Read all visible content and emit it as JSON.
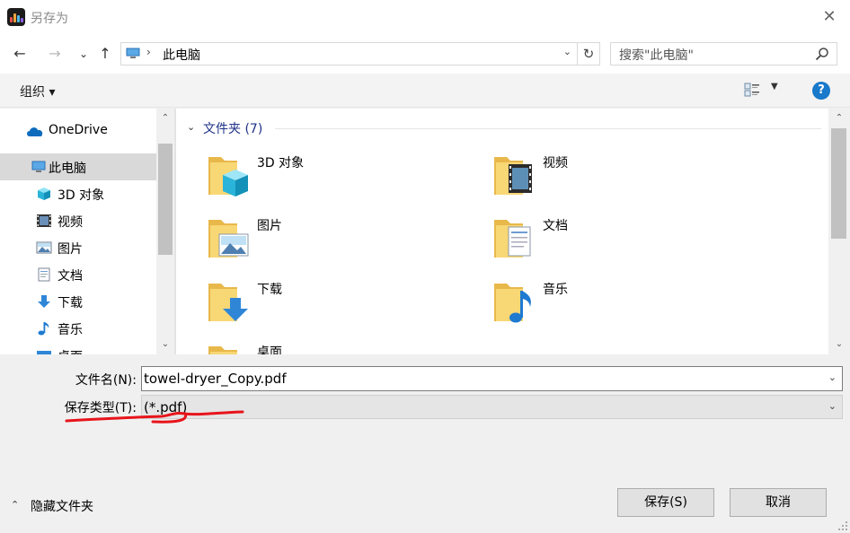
{
  "window": {
    "title": "另存为",
    "close_glyph": "✕",
    "app_icon": "audio-waveform-app-icon"
  },
  "nav": {
    "back_glyph": "←",
    "forward_glyph": "→",
    "recent_glyph": "⌄",
    "up_glyph": "↑",
    "address_chevron": "›",
    "address_text": "此电脑",
    "address_dropdown_glyph": "⌄",
    "refresh_glyph": "↻",
    "search_placeholder": "搜索\"此电脑\""
  },
  "toolbar": {
    "organize_label": "组织 ▾",
    "view_dropdown_glyph": "▼",
    "help_label": "?"
  },
  "sidebar": {
    "items": [
      {
        "label": "OneDrive",
        "icon": "onedrive-cloud-icon"
      },
      {
        "label": "此电脑",
        "icon": "this-pc-icon",
        "selected": true
      },
      {
        "label": "3D 对象",
        "icon": "3d-objects-icon"
      },
      {
        "label": "视频",
        "icon": "videos-icon"
      },
      {
        "label": "图片",
        "icon": "pictures-icon"
      },
      {
        "label": "文档",
        "icon": "documents-icon"
      },
      {
        "label": "下载",
        "icon": "downloads-icon"
      },
      {
        "label": "音乐",
        "icon": "music-icon"
      },
      {
        "label": "桌面",
        "icon": "desktop-icon"
      }
    ],
    "scroll_up_glyph": "⌃",
    "scroll_down_glyph": "⌄"
  },
  "content": {
    "group_chevron": "⌄",
    "group_title": "文件夹 (7)",
    "folders": [
      {
        "label": "3D 对象",
        "icon": "3d-objects-folder-icon"
      },
      {
        "label": "视频",
        "icon": "videos-folder-icon"
      },
      {
        "label": "图片",
        "icon": "pictures-folder-icon"
      },
      {
        "label": "文档",
        "icon": "documents-folder-icon"
      },
      {
        "label": "下载",
        "icon": "downloads-folder-icon"
      },
      {
        "label": "音乐",
        "icon": "music-folder-icon"
      },
      {
        "label": "桌面",
        "icon": "desktop-folder-icon"
      }
    ],
    "scroll_up_glyph": "⌃",
    "scroll_down_glyph": "⌄"
  },
  "form": {
    "filename_label": "文件名(N):",
    "filename_value": "towel-dryer_Copy.pdf",
    "filetype_label": "保存类型(T):",
    "filetype_value": "(*.pdf)",
    "dropdown_glyph": "⌄"
  },
  "footer": {
    "hide_folders_chevron": "⌃",
    "hide_folders_label": "隐藏文件夹",
    "save_label": "保存(S)",
    "cancel_label": "取消"
  },
  "colors": {
    "accent_blue": "#1979ca",
    "group_title_blue": "#1e3287",
    "folder_yellow": "#f8d775",
    "annotation_red": "#e8141b"
  }
}
